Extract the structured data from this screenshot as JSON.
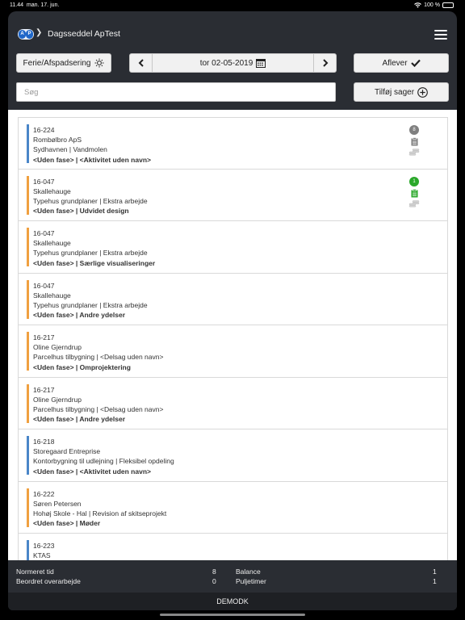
{
  "status_bar": {
    "time": "11.44",
    "date": "man. 17. jun.",
    "battery": "100 %"
  },
  "header": {
    "title": "Dagsseddel ApTest",
    "logo_a": "A",
    "logo_p": "P",
    "separator": "❯"
  },
  "toolbar": {
    "ferie_label": "Ferie/Afspadsering",
    "date": "tor 02-05-2019",
    "prev": "‹",
    "next": "›",
    "aflever_label": "Aflever",
    "search_placeholder": "Søg",
    "tilfoej_label": "Tilføj sager"
  },
  "colors": {
    "blue": "#4a86c8",
    "orange": "#f0a040",
    "green": "#2aa82a",
    "gray": "#7f7f7f"
  },
  "entries": [
    {
      "code": "16-224",
      "client": "Rombølbro ApS",
      "project": "Sydhavnen | Vandmolen",
      "task": "<Uden fase> | <Aktivitet uden navn>",
      "color": "blue",
      "badge": "8",
      "badge_color": "gray"
    },
    {
      "code": "16-047",
      "client": "Skallehauge",
      "project": "Typehus grundplaner | Ekstra arbejde",
      "task": "<Uden fase> | Udvidet design",
      "color": "orange",
      "badge": "1",
      "badge_color": "green"
    },
    {
      "code": "16-047",
      "client": "Skallehauge",
      "project": "Typehus grundplaner | Ekstra arbejde",
      "task": "<Uden fase> | Særlige visualiseringer",
      "color": "orange"
    },
    {
      "code": "16-047",
      "client": "Skallehauge",
      "project": "Typehus grundplaner | Ekstra arbejde",
      "task": "<Uden fase> | Andre ydelser",
      "color": "orange"
    },
    {
      "code": "16-217",
      "client": "Oline Gjerndrup",
      "project": "Parcelhus tilbygning | <Delsag uden navn>",
      "task": "<Uden fase> | Omprojektering",
      "color": "orange"
    },
    {
      "code": "16-217",
      "client": "Oline Gjerndrup",
      "project": "Parcelhus tilbygning | <Delsag uden navn>",
      "task": "<Uden fase> | Andre ydelser",
      "color": "orange"
    },
    {
      "code": "16-218",
      "client": "Storegaard Entreprise",
      "project": "Kontorbygning til udlejning | Fleksibel opdeling",
      "task": "<Uden fase> | <Aktivitet uden navn>",
      "color": "blue"
    },
    {
      "code": "16-222",
      "client": "Søren Petersen",
      "project": "Hohøj Skole - Hal | Revision af skitseprojekt",
      "task": "<Uden fase> | Møder",
      "color": "orange"
    },
    {
      "code": "16-223",
      "client": "KTAS",
      "project": "",
      "task": "",
      "color": "blue"
    }
  ],
  "summary": {
    "normeret_label": "Normeret tid",
    "normeret_value": "8",
    "beordret_label": "Beordret overarbejde",
    "beordret_value": "0",
    "balance_label": "Balance",
    "balance_value": "1",
    "pulje_label": "Puljetimer",
    "pulje_value": "1"
  },
  "footer": {
    "label": "DEMODK"
  }
}
